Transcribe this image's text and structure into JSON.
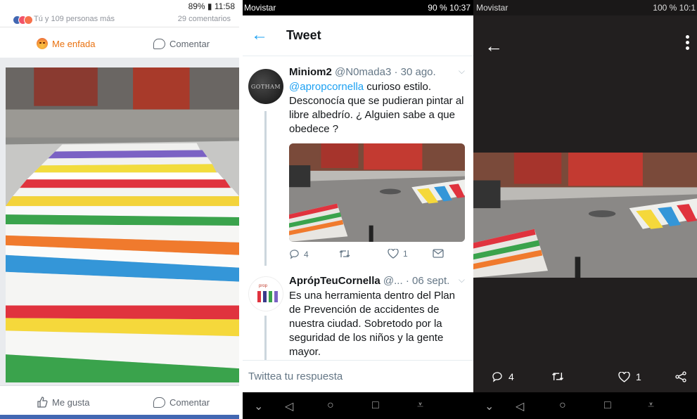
{
  "facebook": {
    "status_right": "89% ▮ 11:58",
    "reactions_text": "Tú y 109 personas más",
    "comments_count": "29 comentarios",
    "reaction_label": "Me enfada",
    "comment_label": "Comentar",
    "like_label": "Me gusta",
    "comment_label_bottom": "Comentar",
    "colors": {
      "angry": "#e9710f",
      "brand": "#4267b2"
    }
  },
  "twitter": {
    "status_carrier": "Movistar",
    "status_right": "90 % 10:37",
    "title": "Tweet",
    "tweets": [
      {
        "name": "Miniom2",
        "handle": "@N0mada3",
        "date": "· 30 ago.",
        "avatar_text": "GOTHAM",
        "mention": "@apropcornella",
        "text": " curioso estilo. Desconocía que se pudieran pintar al libre albedrío. ¿ Alguien sabe a que obedece ?",
        "replies": "4",
        "likes": "1"
      },
      {
        "name": "AprópTeuCornella",
        "handle": "@...",
        "date": "· 06 sept.",
        "text": "Es una herramienta dentro del Plan de Prevención de accidentes de nuestra ciudad. Sobretodo por la seguridad de los niños y la gente mayor."
      }
    ],
    "reply_placeholder": "Twittea tu respuesta",
    "colors": {
      "accent": "#1da1f2"
    }
  },
  "viewer": {
    "status_carrier": "Movistar",
    "status_right": "100 % 10:1",
    "replies": "4",
    "likes": "1"
  },
  "icons": [
    "back-arrow-icon",
    "more-vert-icon",
    "reply-icon",
    "retweet-icon",
    "heart-icon",
    "message-icon",
    "share-icon",
    "thumb-up-icon",
    "comment-icon",
    "angry-emoji-icon"
  ]
}
